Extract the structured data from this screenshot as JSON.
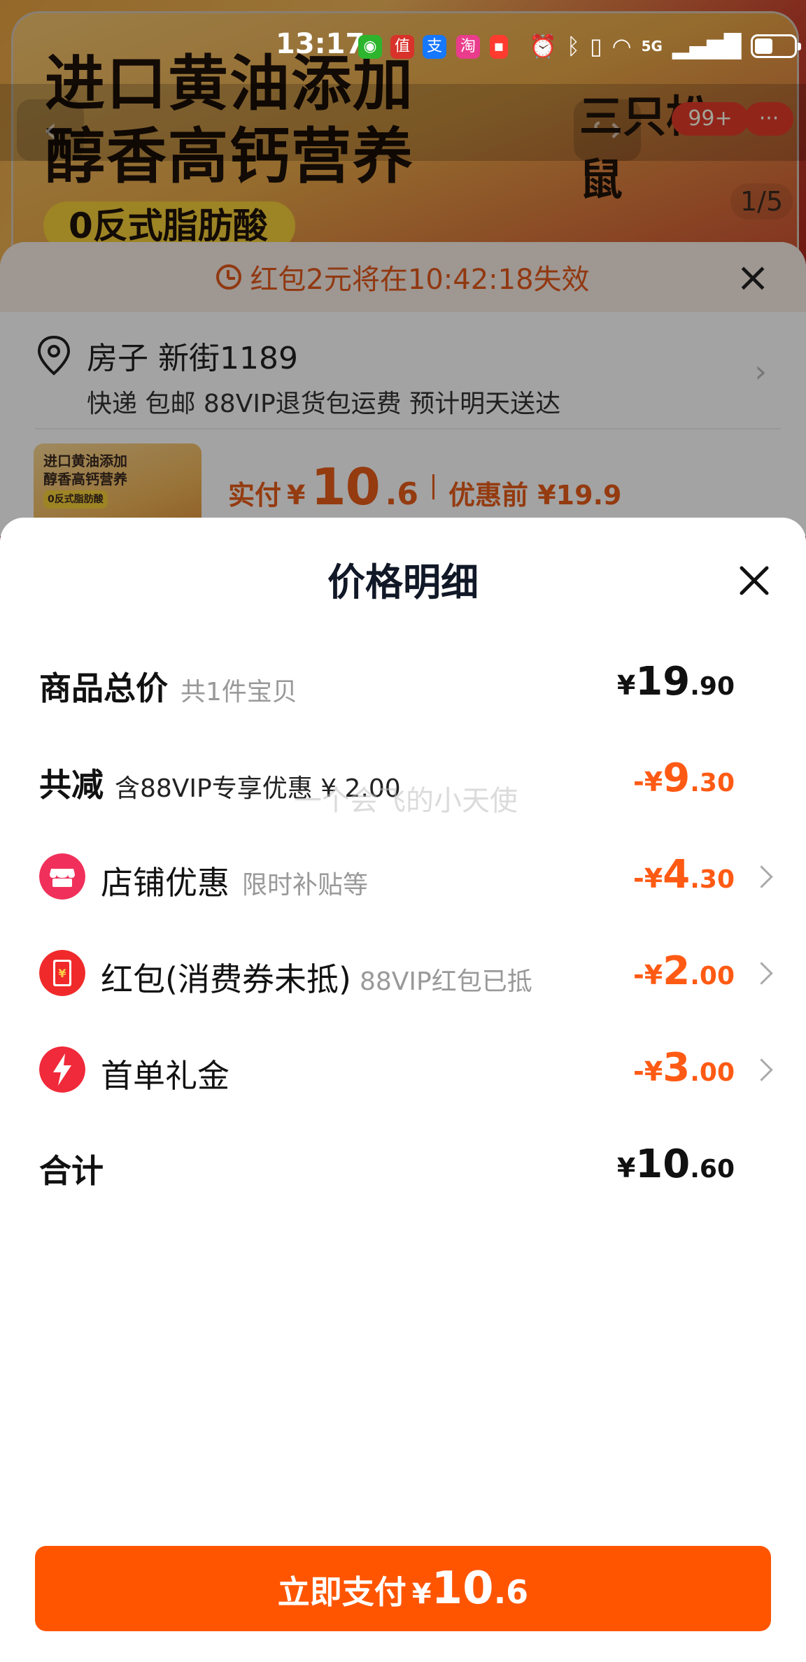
{
  "status_bar": {
    "time": "13:17",
    "network": "5G",
    "app_icons": [
      "wechat-icon",
      "smzdm-icon",
      "alipay-icon",
      "taobao-icon",
      "redpacket-icon"
    ],
    "battery_level": 0.45
  },
  "background": {
    "hero_title_line1": "进口黄油添加",
    "hero_title_line2": "醇香高钙营养",
    "hero_tag": "0反式脂肪酸",
    "brand_text": "三只松鼠",
    "cart_badge": "99+",
    "more_label": "···",
    "image_indicator": "1/5",
    "redpacket_notice": "红包2元将在10:42:18失效",
    "address_name": "房子 新街1189",
    "delivery_info": "快递 包邮 88VIP退货包运费 预计明天送达",
    "thumb_text_line1": "进口黄油添加",
    "thumb_text_line2": "醇香高钙营养",
    "thumb_text_line3": "0反式脂肪酸",
    "paid_label": "实付",
    "paid_yen": "¥",
    "paid_int": "10",
    "paid_dec": ".6",
    "before_discount": "优惠前 ¥19.9"
  },
  "modal": {
    "title": "价格明细",
    "rows": {
      "total": {
        "label": "商品总价",
        "sub": "共1件宝贝",
        "yen": "¥",
        "int": "19",
        "dec": ".90"
      },
      "reduce": {
        "label": "共减",
        "sub": "含88VIP专享优惠 ¥ 2.00",
        "yen": "-¥",
        "int": "9",
        "dec": ".30"
      },
      "shop": {
        "label": "店铺优惠",
        "sub": "限时补贴等",
        "yen": "-¥",
        "int": "4",
        "dec": ".30"
      },
      "redpacket": {
        "label": "红包(消费券未抵)",
        "sub": "88VIP红包已抵",
        "yen": "-¥",
        "int": "2",
        "dec": ".00"
      },
      "first_order": {
        "label": "首单礼金",
        "yen": "-¥",
        "int": "3",
        "dec": ".00"
      },
      "sum": {
        "label": "合计",
        "yen": "¥",
        "int": "10",
        "dec": ".60"
      }
    },
    "watermark": "一个会飞的小天使"
  },
  "pay_button": {
    "label": "立即支付",
    "yen": "¥",
    "int": "10",
    "dec": ".6"
  },
  "colors": {
    "accent_orange": "#ff5500",
    "discount_orange": "#ff5a14",
    "shop_icon_red": "#f0305a",
    "redpacket_icon_red": "#f02a2a"
  }
}
